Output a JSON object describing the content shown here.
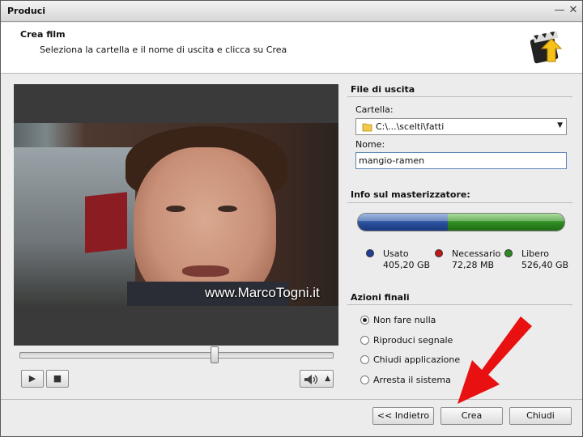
{
  "window": {
    "title": "Produci"
  },
  "header": {
    "title": "Crea film",
    "subtitle": "Seleziona la cartella e il nome di uscita e clicca su Crea",
    "icon": "film-arrow-icon"
  },
  "video": {
    "watermark": "www.MarcoTogni.it"
  },
  "player": {
    "seek_fraction": 0.62,
    "play_icon": "▶",
    "stop_icon": "■",
    "volume_icon": "speaker-icon"
  },
  "output": {
    "section_title": "File di uscita",
    "folder_label": "Cartella:",
    "folder_value": "C:\\...\\scelti\\fatti",
    "name_label": "Nome:",
    "name_value": "mangio-ramen"
  },
  "burner": {
    "section_title": "Info sul masterizzatore:",
    "used_fraction": 0.436,
    "needed_fraction": 0.0001,
    "legend": [
      {
        "name": "Usato",
        "value": "405,20 GB",
        "color": "#1f3f95"
      },
      {
        "name": "Necessario",
        "value": "72,28 MB",
        "color": "#c01818"
      },
      {
        "name": "Libero",
        "value": "526,40 GB",
        "color": "#2e8b22"
      }
    ]
  },
  "final_actions": {
    "section_title": "Azioni finali",
    "options": [
      {
        "label": "Non fare nulla",
        "selected": true
      },
      {
        "label": "Riproduci segnale",
        "selected": false
      },
      {
        "label": "Chiudi applicazione",
        "selected": false
      },
      {
        "label": "Arresta il sistema",
        "selected": false
      }
    ]
  },
  "footer": {
    "back_label": "<< Indietro",
    "create_label": "Crea",
    "close_label": "Chiudi"
  },
  "annotation": {
    "arrow_color": "#e81010"
  }
}
